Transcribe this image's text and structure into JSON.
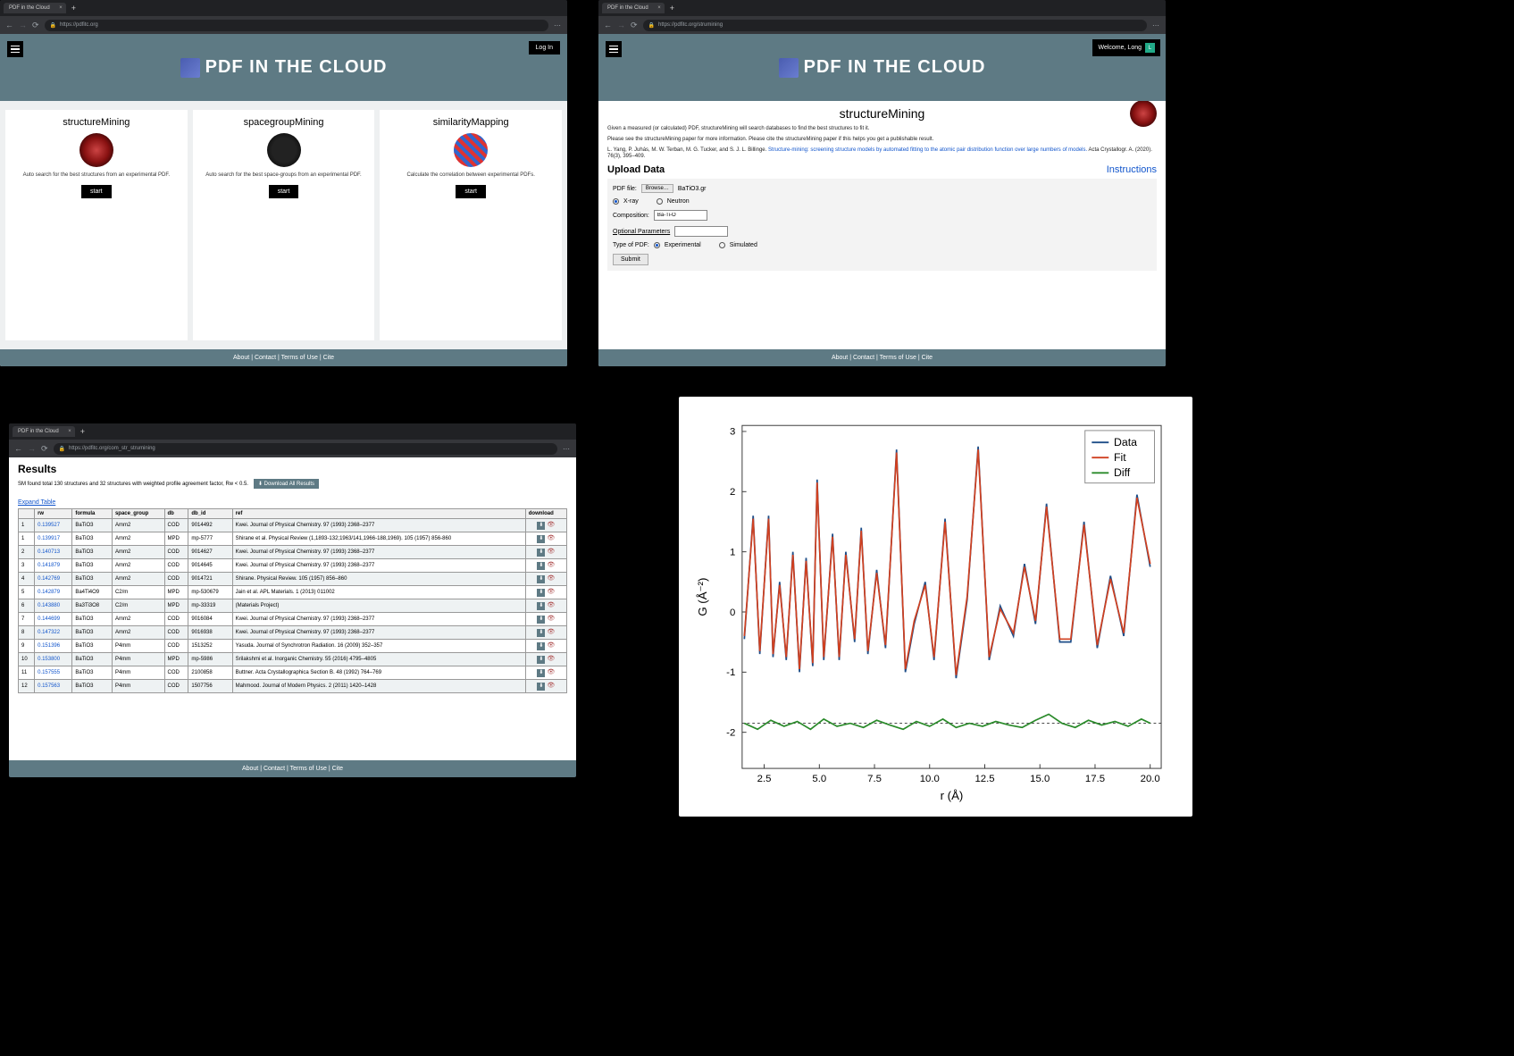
{
  "browser": {
    "tab_title": "PDF in the Cloud",
    "url_home": "https://pdfitc.org",
    "url_mining": "https://pdfitc.org/strumining",
    "url_results": "https://pdfitc.org/com_str_strumining"
  },
  "site": {
    "title": "PDF IN THE CLOUD",
    "login": "Log In",
    "welcome": "Welcome, Long",
    "avatar_initial": "L",
    "footer": "About | Contact | Terms of Use | Cite"
  },
  "home": {
    "cards": [
      {
        "title": "structureMining",
        "desc": "Auto search for the best structures from an experimental PDF.",
        "btn": "start"
      },
      {
        "title": "spacegroupMining",
        "desc": "Auto search for the best space-groups from an experimental PDF.",
        "btn": "start"
      },
      {
        "title": "similarityMapping",
        "desc": "Calculate the correlation between experimental PDFs.",
        "btn": "start"
      }
    ]
  },
  "mining": {
    "title": "structureMining",
    "intro1": "Given a measured (or calculated) PDF, structureMining will search databases to find the best structures to fit it.",
    "intro2": "Please see the structureMining paper for more information. Please cite the structureMining paper if this helps you get a publishable result.",
    "citation_pre": "L. Yang, P. Juhás, M. W. Terban, M. G. Tucker, and S. J. L. Billinge. ",
    "citation_link": "Structure-mining: screening structure models by automated fitting to the atomic pair distribution function over large numbers of models.",
    "citation_post": " Acta Crystallogr. A. (2020). 76(3), 395–409.",
    "upload_heading": "Upload Data",
    "instructions": "Instructions",
    "pdf_file_label": "PDF file:",
    "browse": "Browse…",
    "filename": "BaTiO3.gr",
    "radiation_xray": "X-ray",
    "radiation_neutron": "Neutron",
    "composition_label": "Composition:",
    "composition_value": "Ba-Ti-O",
    "optional_params": "Optional Parameters",
    "type_label": "Type of PDF:",
    "type_exp": "Experimental",
    "type_sim": "Simulated",
    "submit": "Submit"
  },
  "results": {
    "title": "Results",
    "summary": "SM found total 130 structures and 32 structures with weighted profile agreement factor, Rw < 0.5.",
    "download_all": "⬇ Download All Results",
    "expand": "Expand Table",
    "headers": [
      "",
      "rw",
      "formula",
      "space_group",
      "db",
      "db_id",
      "ref",
      "download"
    ],
    "rows": [
      {
        "n": "1",
        "rw": "0.139527",
        "formula": "BaTiO3",
        "sg": "Amm2",
        "db": "COD",
        "id": "9014492",
        "ref": "Kwei. Journal of Physical Chemistry. 97 (1993) 2368–2377"
      },
      {
        "n": "1",
        "rw": "0.139917",
        "formula": "BaTiO3",
        "sg": "Amm2",
        "db": "MPD",
        "id": "mp-5777",
        "ref": "Shirane et al. Physical Review (1,1893-132;1963/141,1966-188,1969). 105 (1957) 856-860"
      },
      {
        "n": "2",
        "rw": "0.140713",
        "formula": "BaTiO3",
        "sg": "Amm2",
        "db": "COD",
        "id": "9014627",
        "ref": "Kwei. Journal of Physical Chemistry. 97 (1993) 2368–2377"
      },
      {
        "n": "3",
        "rw": "0.141879",
        "formula": "BaTiO3",
        "sg": "Amm2",
        "db": "COD",
        "id": "9014645",
        "ref": "Kwei. Journal of Physical Chemistry. 97 (1993) 2368–2377"
      },
      {
        "n": "4",
        "rw": "0.142769",
        "formula": "BaTiO3",
        "sg": "Amm2",
        "db": "COD",
        "id": "9014721",
        "ref": "Shirane. Physical Review. 105 (1957) 856–860"
      },
      {
        "n": "5",
        "rw": "0.142879",
        "formula": "Ba4Ti4O9",
        "sg": "C2/m",
        "db": "MPD",
        "id": "mp-530679",
        "ref": "Jain et al. APL Materials. 1 (2013) 011002"
      },
      {
        "n": "6",
        "rw": "0.143880",
        "formula": "Ba3Ti3O8",
        "sg": "C2/m",
        "db": "MPD",
        "id": "mp-33319",
        "ref": "(Materials Project)"
      },
      {
        "n": "7",
        "rw": "0.144699",
        "formula": "BaTiO3",
        "sg": "Amm2",
        "db": "COD",
        "id": "9016084",
        "ref": "Kwei. Journal of Physical Chemistry. 97 (1993) 2368–2377"
      },
      {
        "n": "8",
        "rw": "0.147322",
        "formula": "BaTiO3",
        "sg": "Amm2",
        "db": "COD",
        "id": "9016938",
        "ref": "Kwei. Journal of Physical Chemistry. 97 (1993) 2368–2377"
      },
      {
        "n": "9",
        "rw": "0.151396",
        "formula": "BaTiO3",
        "sg": "P4mm",
        "db": "COD",
        "id": "1513252",
        "ref": "Yasuda. Journal of Synchrotron Radiation. 16 (2009) 352–357"
      },
      {
        "n": "10",
        "rw": "0.153800",
        "formula": "BaTiO3",
        "sg": "P4mm",
        "db": "MPD",
        "id": "mp-5986",
        "ref": "Srilakshmi et al. Inorganic Chemistry. 55 (2016) 4795–4805"
      },
      {
        "n": "11",
        "rw": "0.157555",
        "formula": "BaTiO3",
        "sg": "P4mm",
        "db": "COD",
        "id": "2100858",
        "ref": "Buttner. Acta Crystallographica Section B. 48 (1992) 764–769"
      },
      {
        "n": "12",
        "rw": "0.157563",
        "formula": "BaTiO3",
        "sg": "P4mm",
        "db": "COD",
        "id": "1507756",
        "ref": "Mahmood. Journal of Modern Physics. 2 (2011) 1420–1428"
      }
    ]
  },
  "chart_data": {
    "type": "line",
    "title": "",
    "xlabel": "r (Å)",
    "ylabel": "G (Å⁻²)",
    "xlim": [
      1.5,
      20.5
    ],
    "ylim": [
      -2.6,
      3.1
    ],
    "xticks": [
      2.5,
      5.0,
      7.5,
      10.0,
      12.5,
      15.0,
      17.5,
      20.0
    ],
    "yticks": [
      -2,
      -1,
      0,
      1,
      2,
      3
    ],
    "legend": [
      "Data",
      "Fit",
      "Diff"
    ],
    "series": [
      {
        "name": "Data",
        "color": "#1f4e88",
        "x": [
          1.6,
          2.0,
          2.3,
          2.7,
          2.9,
          3.2,
          3.5,
          3.8,
          4.1,
          4.4,
          4.7,
          4.9,
          5.2,
          5.6,
          5.9,
          6.2,
          6.6,
          6.9,
          7.2,
          7.6,
          8.0,
          8.5,
          8.9,
          9.3,
          9.8,
          10.2,
          10.7,
          11.2,
          11.7,
          12.2,
          12.7,
          13.2,
          13.8,
          14.3,
          14.8,
          15.3,
          15.9,
          16.4,
          17.0,
          17.6,
          18.2,
          18.8,
          19.4,
          20.0
        ],
        "y": [
          -0.45,
          1.6,
          -0.7,
          1.6,
          -0.75,
          0.5,
          -0.8,
          1.0,
          -1.0,
          0.9,
          -0.9,
          2.2,
          -0.8,
          1.3,
          -0.8,
          1.0,
          -0.5,
          1.4,
          -0.7,
          0.7,
          -0.6,
          2.7,
          -1.0,
          -0.2,
          0.5,
          -0.8,
          1.55,
          -1.1,
          0.2,
          2.75,
          -0.8,
          0.1,
          -0.4,
          0.8,
          -0.2,
          1.8,
          -0.5,
          -0.5,
          1.5,
          -0.6,
          0.6,
          -0.4,
          1.95,
          0.75
        ]
      },
      {
        "name": "Fit",
        "color": "#d04020",
        "x": [
          1.6,
          2.0,
          2.3,
          2.7,
          2.9,
          3.2,
          3.5,
          3.8,
          4.1,
          4.4,
          4.7,
          4.9,
          5.2,
          5.6,
          5.9,
          6.2,
          6.6,
          6.9,
          7.2,
          7.6,
          8.0,
          8.5,
          8.9,
          9.3,
          9.8,
          10.2,
          10.7,
          11.2,
          11.7,
          12.2,
          12.7,
          13.2,
          13.8,
          14.3,
          14.8,
          15.3,
          15.9,
          16.4,
          17.0,
          17.6,
          18.2,
          18.8,
          19.4,
          20.0
        ],
        "y": [
          -0.4,
          1.55,
          -0.65,
          1.55,
          -0.7,
          0.45,
          -0.75,
          0.95,
          -0.95,
          0.85,
          -0.85,
          2.15,
          -0.75,
          1.25,
          -0.75,
          0.95,
          -0.45,
          1.35,
          -0.65,
          0.65,
          -0.55,
          2.65,
          -0.95,
          -0.15,
          0.45,
          -0.75,
          1.5,
          -1.05,
          0.25,
          2.7,
          -0.75,
          0.05,
          -0.35,
          0.75,
          -0.15,
          1.75,
          -0.45,
          -0.45,
          1.45,
          -0.55,
          0.55,
          -0.35,
          1.9,
          0.8
        ]
      },
      {
        "name": "Diff",
        "color": "#2a8a2a",
        "x": [
          1.6,
          2.2,
          2.8,
          3.4,
          4.0,
          4.6,
          5.2,
          5.8,
          6.4,
          7.0,
          7.6,
          8.2,
          8.8,
          9.4,
          10.0,
          10.6,
          11.2,
          11.8,
          12.4,
          13.0,
          13.6,
          14.2,
          14.8,
          15.4,
          16.0,
          16.6,
          17.2,
          17.8,
          18.4,
          19.0,
          19.6,
          20.0
        ],
        "y": [
          -1.85,
          -1.95,
          -1.8,
          -1.9,
          -1.82,
          -1.95,
          -1.78,
          -1.9,
          -1.85,
          -1.92,
          -1.8,
          -1.88,
          -1.95,
          -1.82,
          -1.9,
          -1.78,
          -1.92,
          -1.85,
          -1.9,
          -1.82,
          -1.88,
          -1.92,
          -1.8,
          -1.7,
          -1.85,
          -1.92,
          -1.8,
          -1.88,
          -1.82,
          -1.9,
          -1.78,
          -1.85
        ]
      }
    ],
    "diff_baseline": -1.85
  }
}
